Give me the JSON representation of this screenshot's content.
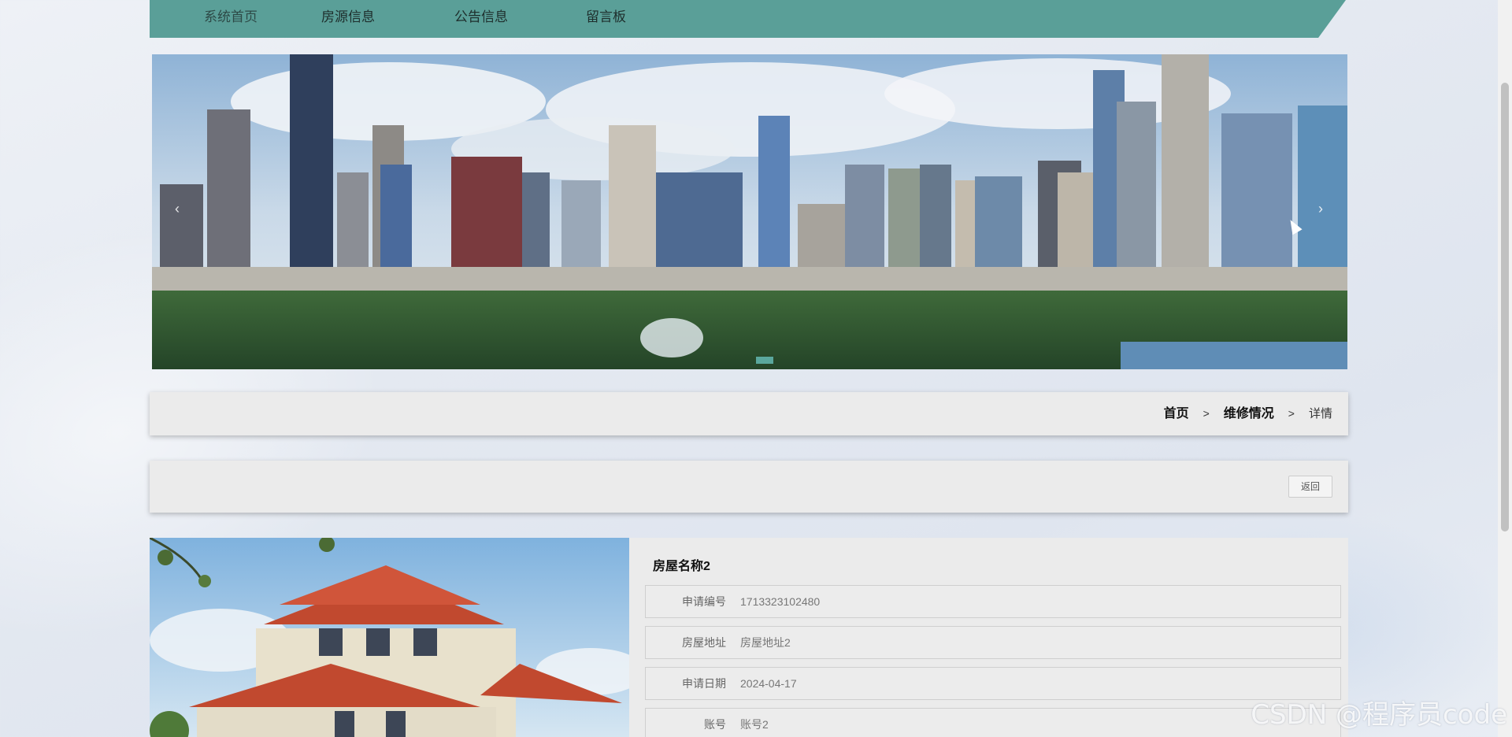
{
  "nav": {
    "items": [
      {
        "label": "系统首页"
      },
      {
        "label": "房源信息"
      },
      {
        "label": "公告信息"
      },
      {
        "label": "留言板"
      }
    ],
    "accent_color": "#5a9f98"
  },
  "carousel": {
    "prev_icon": "‹",
    "next_icon": "›",
    "active_dot_color": "#5aa79d"
  },
  "breadcrumb": {
    "home": "首页",
    "sep": ">",
    "section": "维修情况",
    "current": "详情"
  },
  "actions": {
    "back_label": "返回"
  },
  "detail": {
    "title": "房屋名称2",
    "fields": [
      {
        "label": "申请编号",
        "value": "1713323102480"
      },
      {
        "label": "房屋地址",
        "value": "房屋地址2"
      },
      {
        "label": "申请日期",
        "value": "2024-04-17"
      },
      {
        "label": "账号",
        "value": "账号2"
      }
    ]
  },
  "watermark": "CSDN @程序员code"
}
